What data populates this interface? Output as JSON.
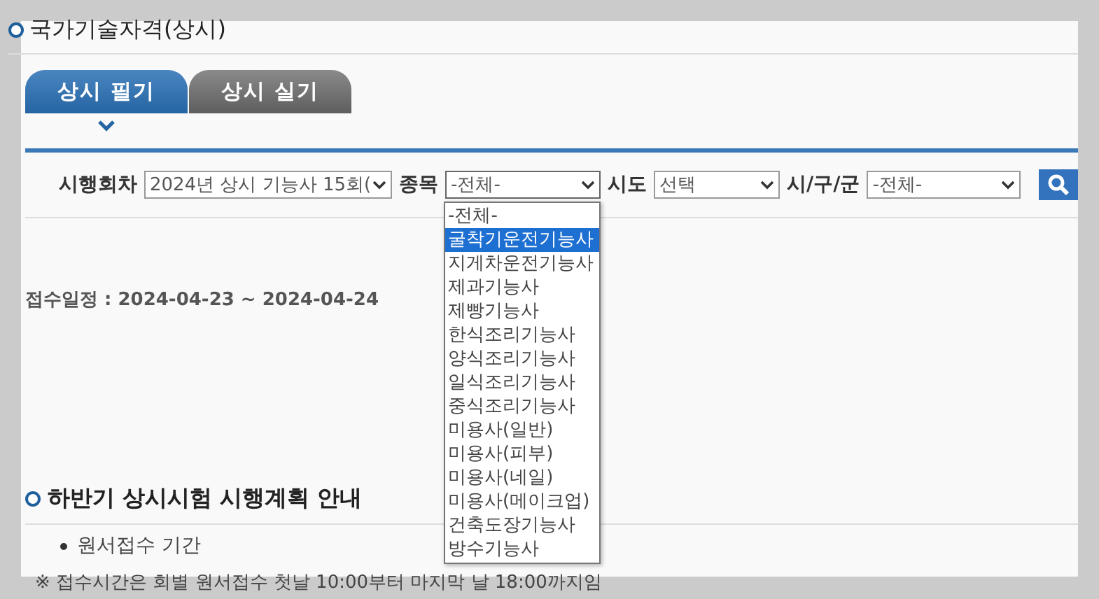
{
  "page_title": "국가기술자격(상시)",
  "tabs": [
    {
      "label": "상시 필기",
      "selected": true
    },
    {
      "label": "상시 실기",
      "selected": false
    }
  ],
  "filters": [
    {
      "label": "시행회차",
      "value": "2024년 상시 기능사 15회(",
      "open": false
    },
    {
      "label": "종목",
      "value": "-전체-",
      "open": true
    },
    {
      "label": "시도",
      "value": "선택",
      "open": false
    },
    {
      "label": "시/구/군",
      "value": "-전체-",
      "open": false
    }
  ],
  "dropdown_options": [
    {
      "label": "-전체-",
      "selected": false
    },
    {
      "label": "굴착기운전기능사",
      "selected": true
    },
    {
      "label": "지게차운전기능사",
      "selected": false
    },
    {
      "label": "제과기능사",
      "selected": false
    },
    {
      "label": "제빵기능사",
      "selected": false
    },
    {
      "label": "한식조리기능사",
      "selected": false
    },
    {
      "label": "양식조리기능사",
      "selected": false
    },
    {
      "label": "일식조리기능사",
      "selected": false
    },
    {
      "label": "중식조리기능사",
      "selected": false
    },
    {
      "label": "미용사(일반)",
      "selected": false
    },
    {
      "label": "미용사(피부)",
      "selected": false
    },
    {
      "label": "미용사(네일)",
      "selected": false
    },
    {
      "label": "미용사(메이크업)",
      "selected": false
    },
    {
      "label": "건축도장기능사",
      "selected": false
    },
    {
      "label": "방수기능사",
      "selected": false
    }
  ],
  "schedule": "접수일정 : 2024-04-23 ~ 2024-04-24",
  "section": {
    "title": "하반기 상시시험 시행계획 안내",
    "items": [
      "원서접수 기간"
    ],
    "note": "※ 접수시간은 회별 원서접수 첫날 10:00부터 마지막 날 18:00까지임"
  }
}
